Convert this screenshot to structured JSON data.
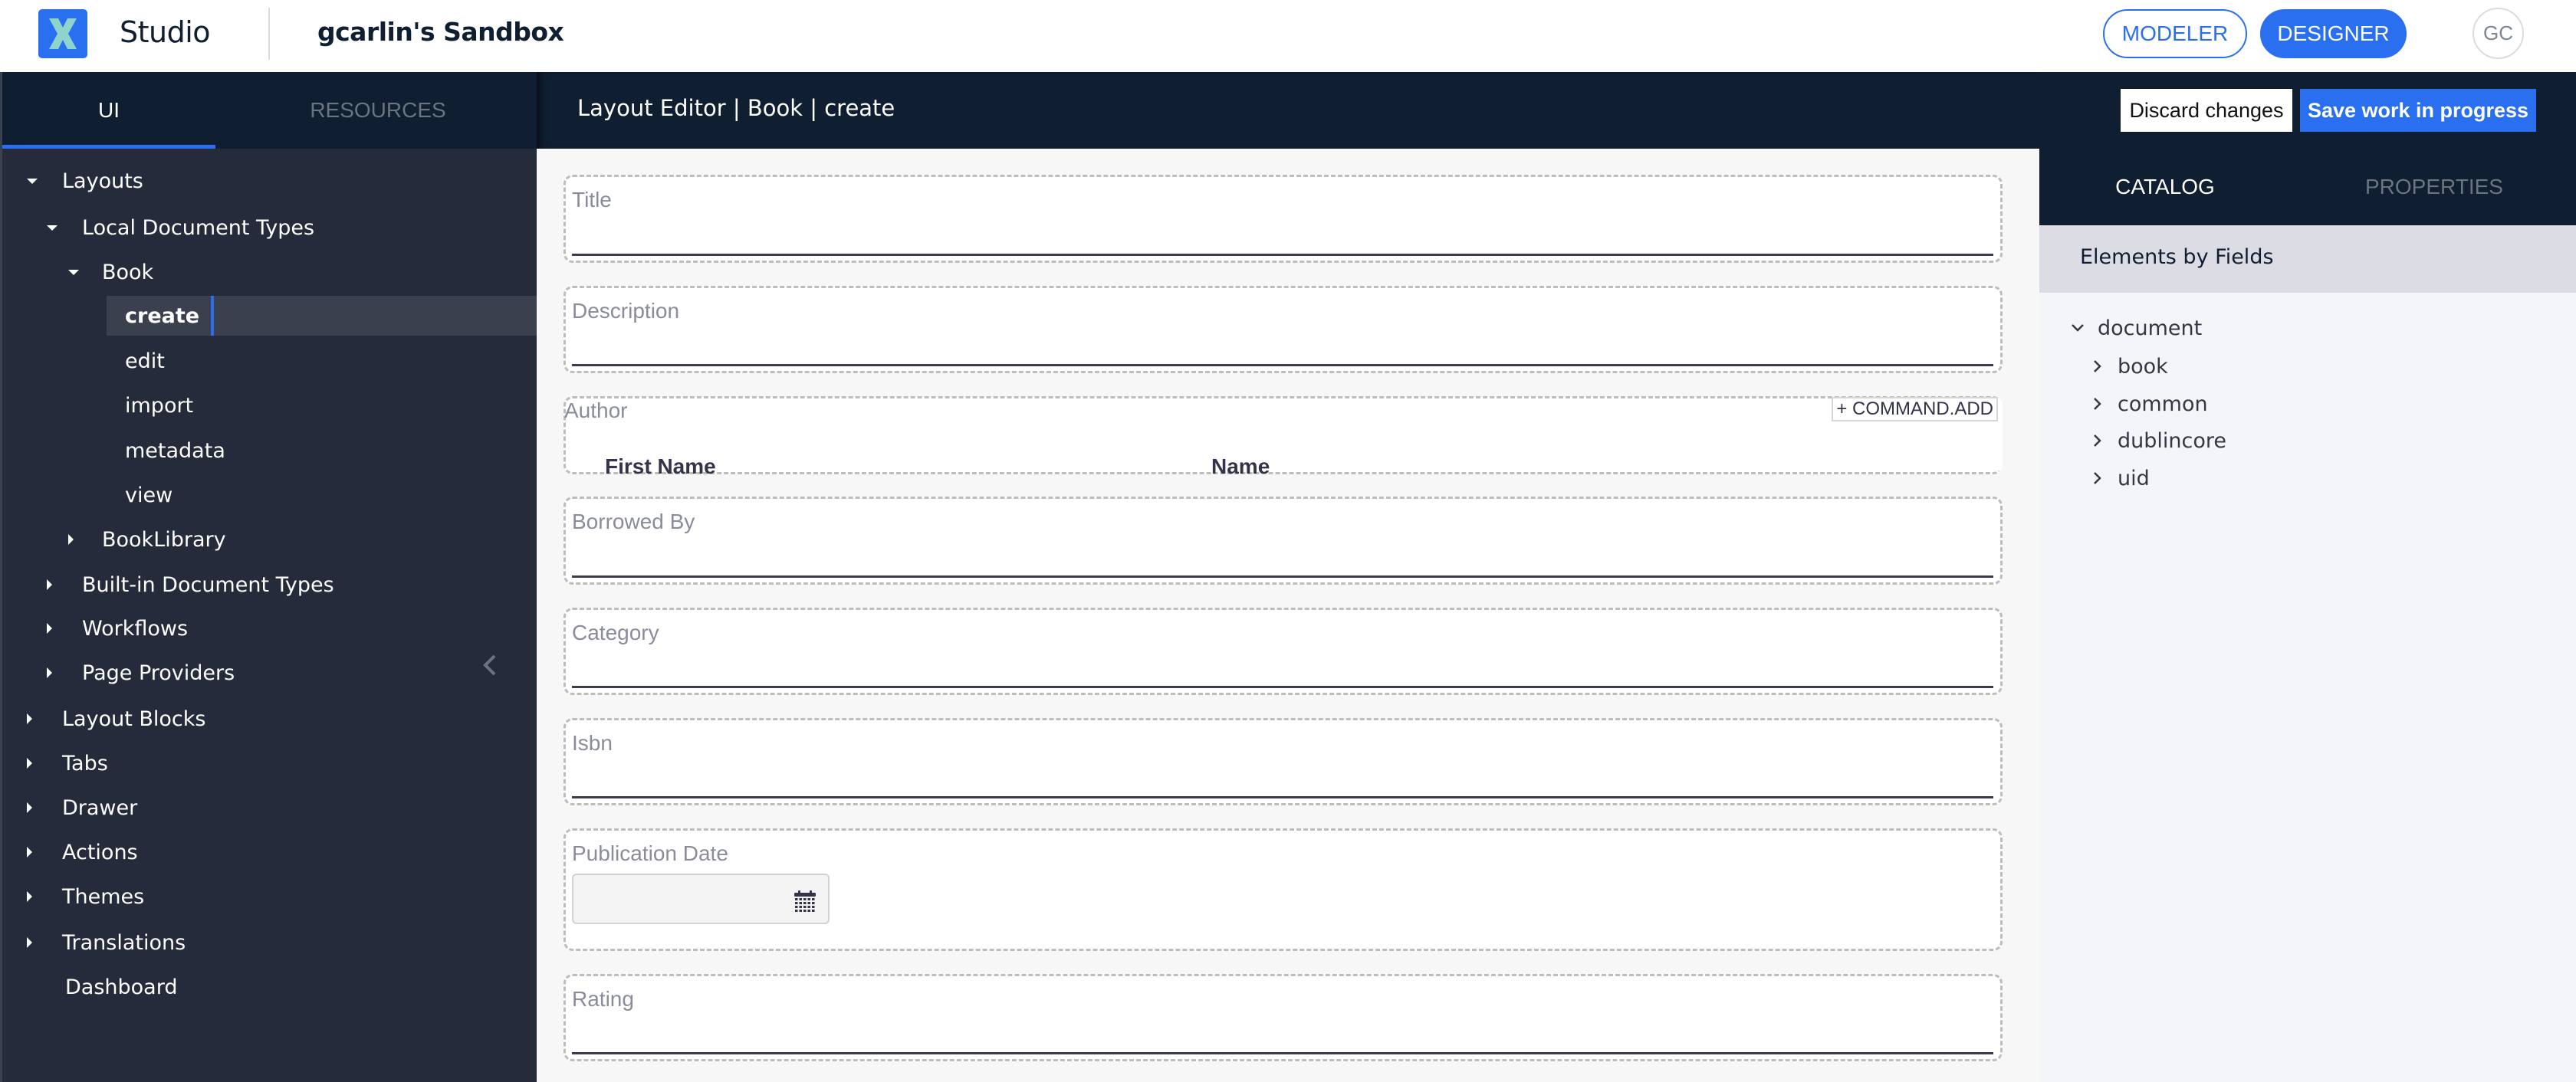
{
  "app": {
    "name": "Studio",
    "project": "gcarlin's Sandbox",
    "modes": [
      {
        "label": "MODELER",
        "active": false
      },
      {
        "label": "DESIGNER",
        "active": true
      }
    ],
    "user_initials": "GC",
    "brand_color": "#2a6ff0"
  },
  "sidebar": {
    "tabs": [
      {
        "label": "UI",
        "active": true
      },
      {
        "label": "RESOURCES",
        "active": false
      }
    ],
    "tree": [
      {
        "label": "Layouts",
        "level": 0,
        "state": "expanded"
      },
      {
        "label": "Local Document Types",
        "level": 1,
        "state": "expanded"
      },
      {
        "label": "Book",
        "level": 2,
        "state": "expanded"
      },
      {
        "label": "create",
        "level": 3,
        "state": "leaf",
        "selected": true
      },
      {
        "label": "edit",
        "level": 3,
        "state": "leaf"
      },
      {
        "label": "import",
        "level": 3,
        "state": "leaf"
      },
      {
        "label": "metadata",
        "level": 3,
        "state": "leaf"
      },
      {
        "label": "view",
        "level": 3,
        "state": "leaf"
      },
      {
        "label": "BookLibrary",
        "level": 2,
        "state": "collapsed"
      },
      {
        "label": "Built-in Document Types",
        "level": 1,
        "state": "collapsed"
      },
      {
        "label": "Workflows",
        "level": 1,
        "state": "collapsed"
      },
      {
        "label": "Page Providers",
        "level": 1,
        "state": "collapsed"
      },
      {
        "label": "Layout Blocks",
        "level": 0,
        "state": "collapsed"
      },
      {
        "label": "Tabs",
        "level": 0,
        "state": "collapsed"
      },
      {
        "label": "Drawer",
        "level": 0,
        "state": "collapsed"
      },
      {
        "label": "Actions",
        "level": 0,
        "state": "collapsed"
      },
      {
        "label": "Themes",
        "level": 0,
        "state": "collapsed"
      },
      {
        "label": "Translations",
        "level": 0,
        "state": "collapsed"
      },
      {
        "label": "Dashboard",
        "level": 0,
        "state": "leaf"
      }
    ]
  },
  "editor": {
    "title": "Layout Editor | Book | create",
    "discard_label": "Discard changes",
    "save_label": "Save work in progress",
    "fields": [
      {
        "label": "Title",
        "type": "text"
      },
      {
        "label": "Description",
        "type": "text"
      },
      {
        "label": "Author",
        "type": "list",
        "columns": [
          "First Name",
          "Name"
        ],
        "add_label": "+ COMMAND.ADD"
      },
      {
        "label": "Borrowed By",
        "type": "text"
      },
      {
        "label": "Category",
        "type": "text"
      },
      {
        "label": "Isbn",
        "type": "text"
      },
      {
        "label": "Publication Date",
        "type": "date",
        "value": ""
      },
      {
        "label": "Rating",
        "type": "text"
      }
    ]
  },
  "catalog": {
    "tabs": [
      {
        "label": "CATALOG",
        "active": true
      },
      {
        "label": "PROPERTIES",
        "active": false
      }
    ],
    "section_title": "Elements by Fields",
    "tree": [
      {
        "label": "document",
        "level": 0,
        "state": "expanded"
      },
      {
        "label": "book",
        "level": 1,
        "state": "collapsed"
      },
      {
        "label": "common",
        "level": 1,
        "state": "collapsed"
      },
      {
        "label": "dublincore",
        "level": 1,
        "state": "collapsed"
      },
      {
        "label": "uid",
        "level": 1,
        "state": "collapsed"
      }
    ]
  }
}
